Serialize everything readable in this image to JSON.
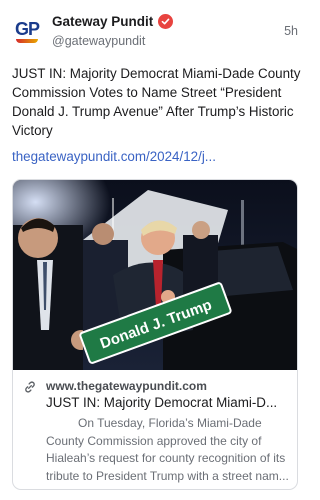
{
  "account": {
    "avatar_text": "GP",
    "display_name": "Gateway Pundit",
    "handle": "@gatewaypundit",
    "timestamp": "5h",
    "verified_icon": "verified-badge-icon",
    "brand_color": "#1b3c8c",
    "badge_color": "#e8433f"
  },
  "post": {
    "text": "JUST IN: Majority Democrat Miami-Dade County Commission Votes to Name Street “President Donald J. Trump Avenue” After Trump’s Historic Victory",
    "link_text": "thegatewaypundit.com/2024/12/j...",
    "link_color": "#3a63c4"
  },
  "card": {
    "image_sign_text": "Donald J. Trump",
    "domain": "www.thegatewaypundit.com",
    "title": "JUST IN: Majority Democrat Miami-D...",
    "description_lines": [
      "On Tuesday, Florida’s Miami-Dade",
      "County Commission approved the city of",
      "Hialeah’s request for county recognition of its",
      "tribute to President Trump with a street nam..."
    ],
    "link_icon": "link-icon"
  }
}
